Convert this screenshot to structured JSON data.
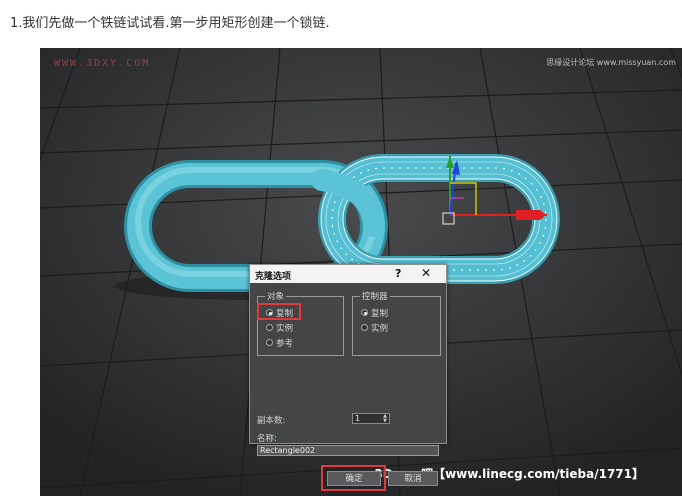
{
  "caption": {
    "number": "1.",
    "text": "我们先做一个铁链试试看.第一步用矩形创建一个锁链."
  },
  "watermarks": {
    "top_left": "WWW.3DXY.COM",
    "top_right": "思缘设计论坛 www.missyuan.com",
    "bottom_right": "3Dmax吧【www.linecg.com/tieba/1771】"
  },
  "dialog": {
    "title": "克隆选项",
    "help": "?",
    "close": "✕",
    "object_group": {
      "label": "对象",
      "options": [
        {
          "label": "复制",
          "selected": true
        },
        {
          "label": "实例",
          "selected": false
        },
        {
          "label": "参考",
          "selected": false
        }
      ]
    },
    "controller_group": {
      "label": "控制器",
      "options": [
        {
          "label": "复制",
          "selected": true
        },
        {
          "label": "实例",
          "selected": false
        }
      ]
    },
    "copies_label": "副本数:",
    "copies_value": "1",
    "name_label": "名称:",
    "name_value": "Rectangle002",
    "ok_label": "确定",
    "cancel_label": "取消"
  },
  "colors": {
    "highlight": "#e03a3a",
    "chain": "#4fb9cd",
    "viewport_bg": "#2f3032"
  }
}
